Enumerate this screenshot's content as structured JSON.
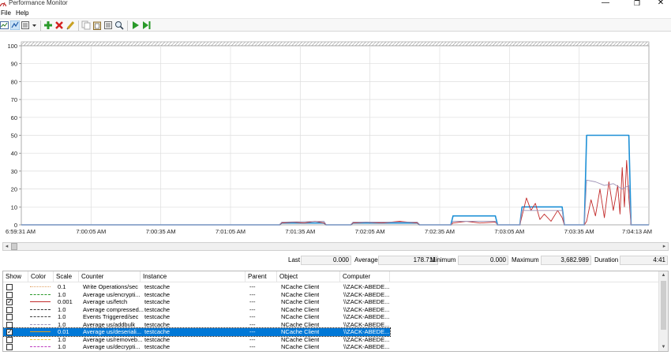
{
  "window": {
    "title": "Performance Monitor",
    "min_glyph": "—",
    "max_glyph": "❐",
    "close_glyph": "✕"
  },
  "menu": {
    "file": "File",
    "help": "Help"
  },
  "toolbar": {
    "icons": [
      "view-graph-icon",
      "change-graph-type-icon",
      "dropdown-icon",
      "add-counter-icon",
      "delete-counter-icon",
      "highlight-icon",
      "copy-properties-icon",
      "paste-counter-list-icon",
      "properties-icon",
      "zoom-icon",
      "unfreeze-display-icon",
      "update-data-icon"
    ]
  },
  "chart_data": {
    "type": "line",
    "ylim": [
      0,
      100
    ],
    "y_ticks": [
      "100",
      "90",
      "80",
      "70",
      "60",
      "50",
      "40",
      "30",
      "20",
      "10",
      "0"
    ],
    "x_ticks": [
      "6:59:31 AM",
      "7:00:05 AM",
      "7:00:35 AM",
      "7:01:05 AM",
      "7:01:35 AM",
      "7:02:05 AM",
      "7:02:35 AM",
      "7:03:05 AM",
      "7:03:35 AM",
      "7:04:13 AM"
    ],
    "time_range_seconds": 282,
    "series": [
      {
        "color": "#1e90d6",
        "points": [
          [
            0,
            0
          ],
          [
            116,
            0
          ],
          [
            117,
            1
          ],
          [
            136,
            1
          ],
          [
            137,
            0
          ],
          [
            148,
            0
          ],
          [
            149,
            1
          ],
          [
            178,
            1
          ],
          [
            179,
            0
          ],
          [
            193,
            0
          ],
          [
            194,
            5
          ],
          [
            213,
            5
          ],
          [
            214,
            0
          ],
          [
            224,
            0
          ],
          [
            225,
            10
          ],
          [
            243,
            10
          ],
          [
            244,
            0
          ],
          [
            253,
            0
          ],
          [
            254,
            50
          ],
          [
            273,
            50
          ],
          [
            274,
            0
          ],
          [
            282,
            0
          ]
        ]
      },
      {
        "color": "#c22a2a",
        "points": [
          [
            0,
            0
          ],
          [
            116,
            0
          ],
          [
            117,
            1
          ],
          [
            122,
            1.5
          ],
          [
            127,
            1
          ],
          [
            132,
            2
          ],
          [
            136,
            1
          ],
          [
            137,
            0
          ],
          [
            148,
            0
          ],
          [
            149,
            1
          ],
          [
            155,
            1.5
          ],
          [
            162,
            1
          ],
          [
            170,
            2
          ],
          [
            178,
            1
          ],
          [
            179,
            0
          ],
          [
            193,
            0
          ],
          [
            194,
            1
          ],
          [
            200,
            2
          ],
          [
            206,
            1
          ],
          [
            213,
            1.5
          ],
          [
            214,
            0
          ],
          [
            224,
            0
          ],
          [
            225,
            5
          ],
          [
            227,
            15
          ],
          [
            229,
            8
          ],
          [
            231,
            12
          ],
          [
            233,
            3
          ],
          [
            235,
            6
          ],
          [
            238,
            2
          ],
          [
            241,
            8
          ],
          [
            243,
            4
          ],
          [
            244,
            0
          ],
          [
            253,
            0
          ],
          [
            254,
            2
          ],
          [
            256,
            14
          ],
          [
            258,
            5
          ],
          [
            260,
            20
          ],
          [
            262,
            4
          ],
          [
            264,
            24
          ],
          [
            266,
            8
          ],
          [
            268,
            22
          ],
          [
            269,
            6
          ],
          [
            270,
            32
          ],
          [
            271,
            10
          ],
          [
            272,
            36
          ],
          [
            273,
            15
          ],
          [
            274,
            0
          ],
          [
            282,
            0
          ]
        ]
      },
      {
        "color": "#9e93b7",
        "points": [
          [
            0,
            0
          ],
          [
            116,
            0
          ],
          [
            117,
            1.5
          ],
          [
            136,
            2
          ],
          [
            137,
            0
          ],
          [
            148,
            0
          ],
          [
            149,
            1.5
          ],
          [
            178,
            1.5
          ],
          [
            179,
            0
          ],
          [
            193,
            0
          ],
          [
            194,
            2
          ],
          [
            213,
            2
          ],
          [
            214,
            0
          ],
          [
            224,
            0
          ],
          [
            225,
            8
          ],
          [
            243,
            8
          ],
          [
            244,
            0
          ],
          [
            253,
            0
          ],
          [
            254,
            25
          ],
          [
            258,
            24
          ],
          [
            262,
            22
          ],
          [
            266,
            23
          ],
          [
            270,
            20
          ],
          [
            273,
            22
          ],
          [
            274,
            0
          ],
          [
            282,
            0
          ]
        ]
      }
    ]
  },
  "stats": {
    "last_label": "Last",
    "last_value": "0.000",
    "average_label": "Average",
    "average_value": "178.711",
    "minimum_label": "Minimum",
    "minimum_value": "0.000",
    "maximum_label": "Maximum",
    "maximum_value": "3,682.989",
    "duration_label": "Duration",
    "duration_value": "4:41"
  },
  "columns": [
    "Show",
    "Color",
    "Scale",
    "Counter",
    "Instance",
    "Parent",
    "Object",
    "Computer"
  ],
  "rows": [
    {
      "show": false,
      "color": "#e0a060",
      "style": "dotted",
      "scale": "0.1",
      "counter": "Write Operations/sec",
      "instance": "testcache",
      "parent": "---",
      "object": "NCache Client",
      "computer": "\\\\ZACK-ABEDE...",
      "selected": false
    },
    {
      "show": false,
      "color": "#2a9a2a",
      "style": "dashed",
      "scale": "1.0",
      "counter": "Average us/encrypti...",
      "instance": "testcache",
      "parent": "---",
      "object": "NCache Client",
      "computer": "\\\\ZACK-ABEDE...",
      "selected": false
    },
    {
      "show": true,
      "color": "#c22a2a",
      "style": "solid",
      "scale": "0.001",
      "counter": "Average us/fetch",
      "instance": "testcache",
      "parent": "---",
      "object": "NCache Client",
      "computer": "\\\\ZACK-ABEDE...",
      "selected": false
    },
    {
      "show": false,
      "color": "#333333",
      "style": "dashed",
      "scale": "1.0",
      "counter": "Average compressed...",
      "instance": "testcache",
      "parent": "---",
      "object": "NCache Client",
      "computer": "\\\\ZACK-ABEDE...",
      "selected": false
    },
    {
      "show": false,
      "color": "#444444",
      "style": "dashed",
      "scale": "1.0",
      "counter": "Events Triggered/sec",
      "instance": "testcache",
      "parent": "---",
      "object": "NCache Client",
      "computer": "\\\\ZACK-ABEDE...",
      "selected": false
    },
    {
      "show": false,
      "color": "#9e93b7",
      "style": "dashed",
      "scale": "1.0",
      "counter": "Average us/addbulk",
      "instance": "testcache",
      "parent": "---",
      "object": "NCache Client",
      "computer": "\\\\ZACK-ABEDE...",
      "selected": false
    },
    {
      "show": true,
      "color": "#e0a020",
      "style": "solid",
      "scale": "0.01",
      "counter": "Average us/deseriali...",
      "instance": "testcache",
      "parent": "---",
      "object": "NCache Client",
      "computer": "\\\\ZACK-ABEDE...",
      "selected": true
    },
    {
      "show": false,
      "color": "#e8c040",
      "style": "dashed",
      "scale": "1.0",
      "counter": "Average us/removeb...",
      "instance": "testcache",
      "parent": "---",
      "object": "NCache Client",
      "computer": "\\\\ZACK-ABEDE...",
      "selected": false
    },
    {
      "show": false,
      "color": "#c040c0",
      "style": "dashed",
      "scale": "1.0",
      "counter": "Average us/decrypti...",
      "instance": "testcache",
      "parent": "---",
      "object": "NCache Client",
      "computer": "\\\\ZACK-ABEDE...",
      "selected": false
    }
  ]
}
